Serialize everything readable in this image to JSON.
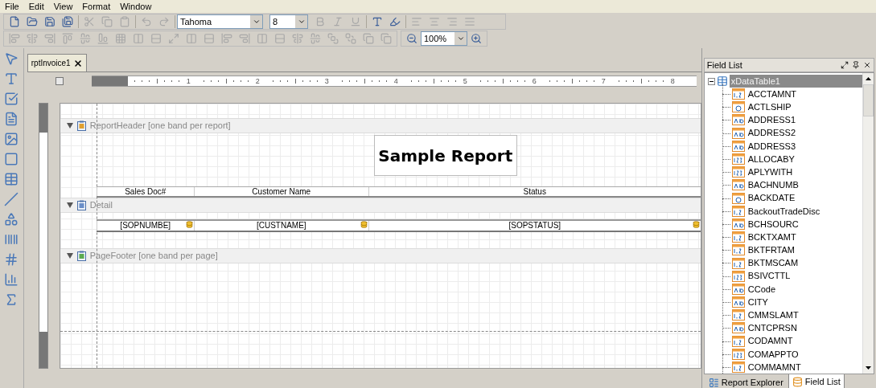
{
  "menu": [
    "File",
    "Edit",
    "View",
    "Format",
    "Window"
  ],
  "toolbar": {
    "font": "Tahoma",
    "size": "8",
    "zoom": "100%"
  },
  "document_tab": {
    "label": "rptInvoice1",
    "selected": true
  },
  "ruler_marks": [
    "1",
    "2",
    "3",
    "4",
    "5",
    "6",
    "7",
    "8"
  ],
  "report": {
    "title": "Sample Report",
    "bands": [
      {
        "kind": "header",
        "label": "ReportHeader [one band per report]",
        "expanded": true
      },
      {
        "kind": "detail",
        "label": "Detail",
        "expanded": true
      },
      {
        "kind": "footer",
        "label": "PageFooter [one band per page]",
        "expanded": true
      }
    ],
    "columns": [
      "Sales Doc#",
      "Customer Name",
      "Status"
    ],
    "fields": [
      "[SOPNUMBE]",
      "[CUSTNAME]",
      "[SOPSTATUS]"
    ]
  },
  "field_list": {
    "title": "Field List",
    "root": {
      "label": "xDataTable1",
      "expanded": true,
      "selected": true,
      "children": [
        {
          "label": "ACCTAMNT",
          "kind": "decimal"
        },
        {
          "label": "ACTLSHIP",
          "kind": "date"
        },
        {
          "label": "ADDRESS1",
          "kind": "text"
        },
        {
          "label": "ADDRESS2",
          "kind": "text"
        },
        {
          "label": "ADDRESS3",
          "kind": "text"
        },
        {
          "label": "ALLOCABY",
          "kind": "integer"
        },
        {
          "label": "APLYWITH",
          "kind": "integer"
        },
        {
          "label": "BACHNUMB",
          "kind": "text"
        },
        {
          "label": "BACKDATE",
          "kind": "date"
        },
        {
          "label": "BackoutTradeDisc",
          "kind": "decimal"
        },
        {
          "label": "BCHSOURC",
          "kind": "text"
        },
        {
          "label": "BCKTXAMT",
          "kind": "decimal"
        },
        {
          "label": "BKTFRTAM",
          "kind": "decimal"
        },
        {
          "label": "BKTMSCAM",
          "kind": "decimal"
        },
        {
          "label": "BSIVCTTL",
          "kind": "integer"
        },
        {
          "label": "CCode",
          "kind": "text"
        },
        {
          "label": "CITY",
          "kind": "text"
        },
        {
          "label": "CMMSLAMT",
          "kind": "decimal"
        },
        {
          "label": "CNTCPRSN",
          "kind": "text"
        },
        {
          "label": "CODAMNT",
          "kind": "decimal"
        },
        {
          "label": "COMAPPTO",
          "kind": "integer"
        },
        {
          "label": "COMMAMNT",
          "kind": "decimal"
        }
      ]
    }
  },
  "panel_tabs": [
    {
      "label": "Report Explorer",
      "selected": false
    },
    {
      "label": "Field List",
      "selected": true
    }
  ]
}
